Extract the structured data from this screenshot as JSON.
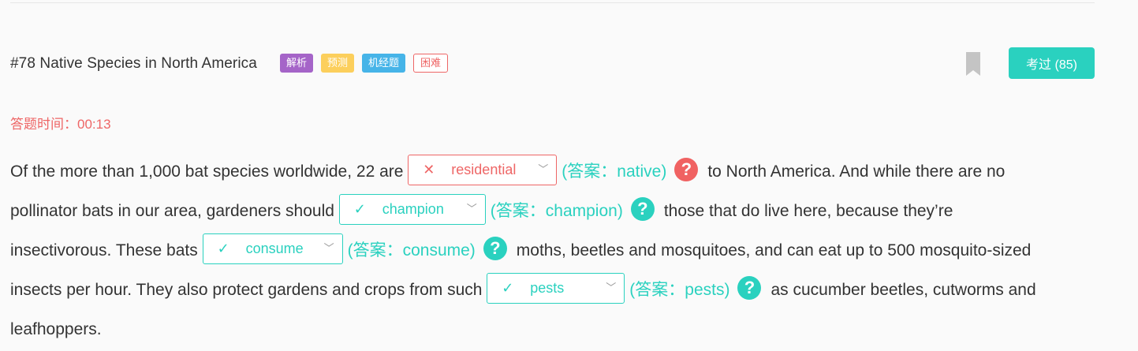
{
  "question": {
    "title": "#78 Native Species in North America",
    "tags": [
      "解析",
      "预测",
      "机经题",
      "困难"
    ],
    "exam_button": "考过 (85)"
  },
  "timer": "答题时间：00:13",
  "passage": {
    "l1_a": "Of the more than 1,000 bat species worldwide, 22 are",
    "blank1": {
      "mark": "✕",
      "word": "residential",
      "answer": "(答案：native)"
    },
    "l1_b": "to North America. And while there are no",
    "l2_a": "pollinator bats in our area, gardeners should",
    "blank2": {
      "mark": "✓",
      "word": "champion",
      "answer": "(答案：champion)"
    },
    "l2_b": "those that do live here, because they’re",
    "l3_a": "insectivorous. These bats",
    "blank3": {
      "mark": "✓",
      "word": "consume",
      "answer": "(答案：consume)"
    },
    "l3_b": "moths, beetles and mosquitoes, and can eat up to 500 mosquito-sized",
    "l4_a": "insects per hour. They also protect gardens and crops from such",
    "blank4": {
      "mark": "✓",
      "word": "pests",
      "answer": "(答案：pests)"
    },
    "l4_b": "as cucumber beetles, cutworms and",
    "l5": "leafhoppers."
  },
  "icons": {
    "help": "?",
    "chevron": "﹀"
  },
  "colors": {
    "accent": "#2ad1bf",
    "error": "#ee6666",
    "tag_analysis": "#a564c8",
    "tag_predict": "#fccf5c",
    "tag_machine": "#46b4e8"
  }
}
